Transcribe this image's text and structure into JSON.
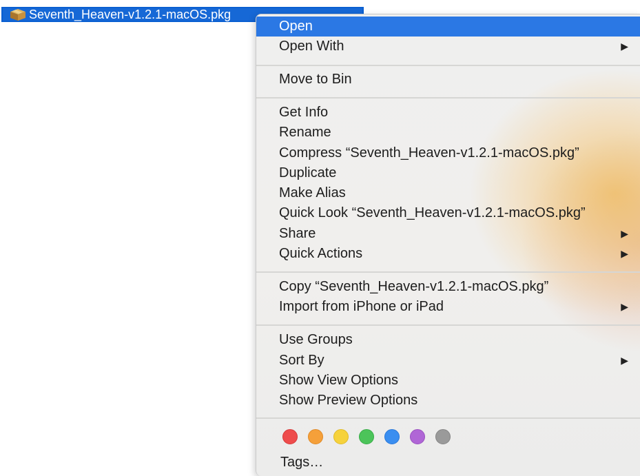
{
  "file": {
    "name": "Seventh_Heaven-v1.2.1-macOS.pkg",
    "icon": "package-icon"
  },
  "menu": {
    "items": [
      {
        "id": "open",
        "label": "Open",
        "submenu": false,
        "highlighted": true
      },
      {
        "id": "open-with",
        "label": "Open With",
        "submenu": true
      },
      {
        "id": "move-to-bin",
        "label": "Move to Bin",
        "submenu": false
      },
      {
        "id": "get-info",
        "label": "Get Info",
        "submenu": false
      },
      {
        "id": "rename",
        "label": "Rename",
        "submenu": false
      },
      {
        "id": "compress",
        "label": "Compress “Seventh_Heaven-v1.2.1-macOS.pkg”",
        "submenu": false
      },
      {
        "id": "duplicate",
        "label": "Duplicate",
        "submenu": false
      },
      {
        "id": "make-alias",
        "label": "Make Alias",
        "submenu": false
      },
      {
        "id": "quick-look",
        "label": "Quick Look “Seventh_Heaven-v1.2.1-macOS.pkg”",
        "submenu": false
      },
      {
        "id": "share",
        "label": "Share",
        "submenu": true
      },
      {
        "id": "quick-actions",
        "label": "Quick Actions",
        "submenu": true
      },
      {
        "id": "copy",
        "label": "Copy “Seventh_Heaven-v1.2.1-macOS.pkg”",
        "submenu": false
      },
      {
        "id": "import-iphone",
        "label": "Import from iPhone or iPad",
        "submenu": true
      },
      {
        "id": "use-groups",
        "label": "Use Groups",
        "submenu": false
      },
      {
        "id": "sort-by",
        "label": "Sort By",
        "submenu": true
      },
      {
        "id": "show-view-options",
        "label": "Show View Options",
        "submenu": false
      },
      {
        "id": "show-preview-options",
        "label": "Show Preview Options",
        "submenu": false
      }
    ],
    "submenu_arrow": "▶",
    "tag_colors": [
      {
        "name": "red",
        "color": "#ee4c4c",
        "border": "#d63a3a"
      },
      {
        "name": "orange",
        "color": "#f5a03a",
        "border": "#e08a28"
      },
      {
        "name": "yellow",
        "color": "#f6d23c",
        "border": "#e0bb2a"
      },
      {
        "name": "green",
        "color": "#4cc45a",
        "border": "#39ad48"
      },
      {
        "name": "blue",
        "color": "#3a8ef0",
        "border": "#2a78d8"
      },
      {
        "name": "purple",
        "color": "#b066d6",
        "border": "#9a52c0"
      },
      {
        "name": "gray",
        "color": "#9a9a9a",
        "border": "#858585"
      }
    ],
    "tags_label": "Tags…"
  }
}
